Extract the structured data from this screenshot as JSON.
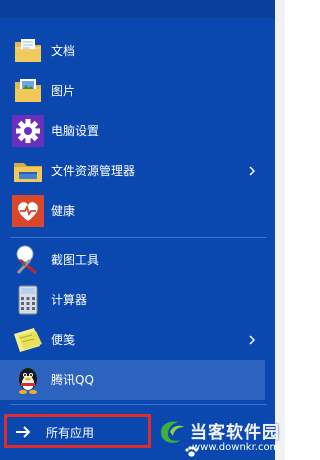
{
  "menu": {
    "items": [
      {
        "label": "文档",
        "icon": "documents-folder-icon"
      },
      {
        "label": "图片",
        "icon": "pictures-folder-icon"
      },
      {
        "label": "电脑设置",
        "icon": "gear-icon"
      },
      {
        "label": "文件资源管理器",
        "icon": "file-explorer-icon"
      },
      {
        "label": "健康",
        "icon": "health-heart-icon"
      },
      {
        "label": "截图工具",
        "icon": "snipping-tool-icon"
      },
      {
        "label": "计算器",
        "icon": "calculator-icon"
      },
      {
        "label": "便笺",
        "icon": "sticky-notes-icon"
      },
      {
        "label": "腾讯QQ",
        "icon": "qq-penguin-icon"
      }
    ],
    "all_apps_label": "所有应用"
  },
  "watermark": {
    "title": "当客软件园",
    "url": "www.downkr.com"
  },
  "colors": {
    "menu_bg": "#0a48b0",
    "highlight": "#2c63bf",
    "callout_border": "#e02c2c"
  }
}
